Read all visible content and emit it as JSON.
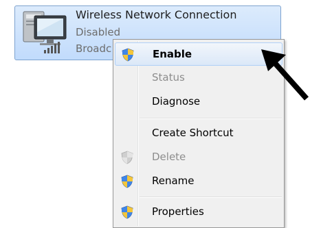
{
  "connection": {
    "name": "Wireless Network Connection",
    "status": "Disabled",
    "device": "Broadc"
  },
  "context_menu": {
    "items": [
      {
        "label": "Enable",
        "icon": "shield-icon",
        "enabled": true,
        "bold": true,
        "highlighted": true
      },
      {
        "label": "Status",
        "icon": "",
        "enabled": false
      },
      {
        "label": "Diagnose",
        "icon": "",
        "enabled": true
      },
      {
        "label": "Create Shortcut",
        "icon": "",
        "enabled": true
      },
      {
        "label": "Delete",
        "icon": "shield-icon",
        "enabled": false
      },
      {
        "label": "Rename",
        "icon": "shield-icon",
        "enabled": true
      },
      {
        "label": "Properties",
        "icon": "shield-icon",
        "enabled": true
      }
    ]
  },
  "colors": {
    "tile_border": "#7da2ce",
    "highlight_border": "#aecff7",
    "disabled_text": "#8d8d8d",
    "arrow": "#000000"
  }
}
